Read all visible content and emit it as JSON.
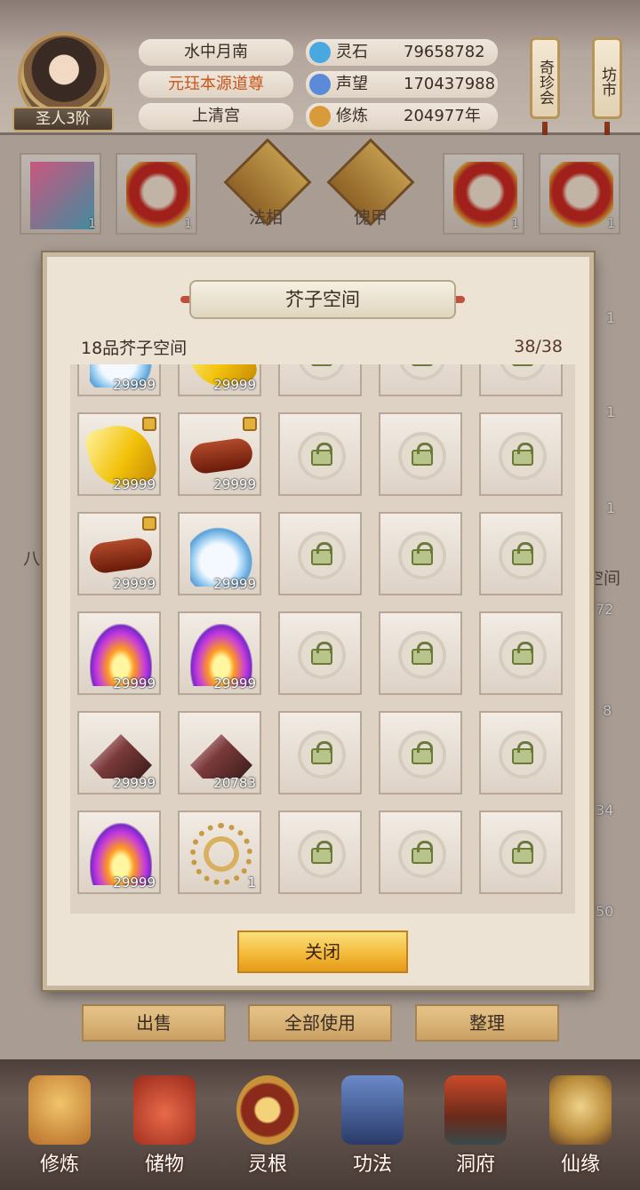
{
  "header": {
    "rank": "圣人3阶",
    "name": "水中月南",
    "title": "元珏本源道尊",
    "sect": "上清宫",
    "stats": [
      {
        "label": "灵石",
        "value": "79658782",
        "icon": "spirit-stone-icon",
        "color": "#4aa8e0"
      },
      {
        "label": "声望",
        "value": "170437988",
        "icon": "reputation-icon",
        "color": "#5a8ad8"
      },
      {
        "label": "修炼",
        "value": "204977年",
        "icon": "cultivation-icon",
        "color": "#d99a3a"
      }
    ],
    "side_buttons": [
      "奇珍会",
      "坊市"
    ]
  },
  "background": {
    "tabs": [
      "法相",
      "傀甲"
    ],
    "side_label_left": "八",
    "side_label_right": "空间",
    "left_slot_counts": [
      "1",
      "1"
    ],
    "right_slot_counts": [
      "1",
      "1"
    ],
    "side_numbers": [
      "1",
      "1",
      "1",
      "72",
      "8",
      "34",
      "50"
    ]
  },
  "actions": {
    "sell": "出售",
    "use_all": "全部使用",
    "sort": "整理"
  },
  "modal": {
    "title": "芥子空间",
    "subtitle": "18品芥子空间",
    "capacity": "38/38",
    "close_label": "关闭",
    "items": [
      {
        "art": "art-gourd",
        "count": "29999",
        "locked": false
      },
      {
        "art": "art-jade",
        "count": "29999",
        "locked": false
      },
      {
        "art": "art-jade",
        "count": "29999",
        "locked": true
      },
      {
        "art": "art-wood",
        "count": "29999",
        "locked": true
      },
      {
        "art": "art-wood",
        "count": "29999",
        "locked": true
      },
      {
        "art": "art-gourd",
        "count": "29999",
        "locked": false
      },
      {
        "art": "art-fire",
        "count": "29999",
        "locked": false
      },
      {
        "art": "art-fire",
        "count": "29999",
        "locked": false
      },
      {
        "art": "art-ore",
        "count": "29999",
        "locked": false
      },
      {
        "art": "art-ore",
        "count": "20783",
        "locked": false
      },
      {
        "art": "art-fire",
        "count": "29999",
        "locked": false
      },
      {
        "art": "art-beads",
        "count": "1",
        "locked": false
      }
    ]
  },
  "bottom_nav": [
    {
      "label": "修炼",
      "icon": "cultivation-monk-icon"
    },
    {
      "label": "储物",
      "icon": "storage-bag-icon"
    },
    {
      "label": "灵根",
      "icon": "spirit-root-icon"
    },
    {
      "label": "功法",
      "icon": "technique-book-icon"
    },
    {
      "label": "洞府",
      "icon": "cave-mansion-icon"
    },
    {
      "label": "仙缘",
      "icon": "immortal-fate-icon"
    }
  ]
}
